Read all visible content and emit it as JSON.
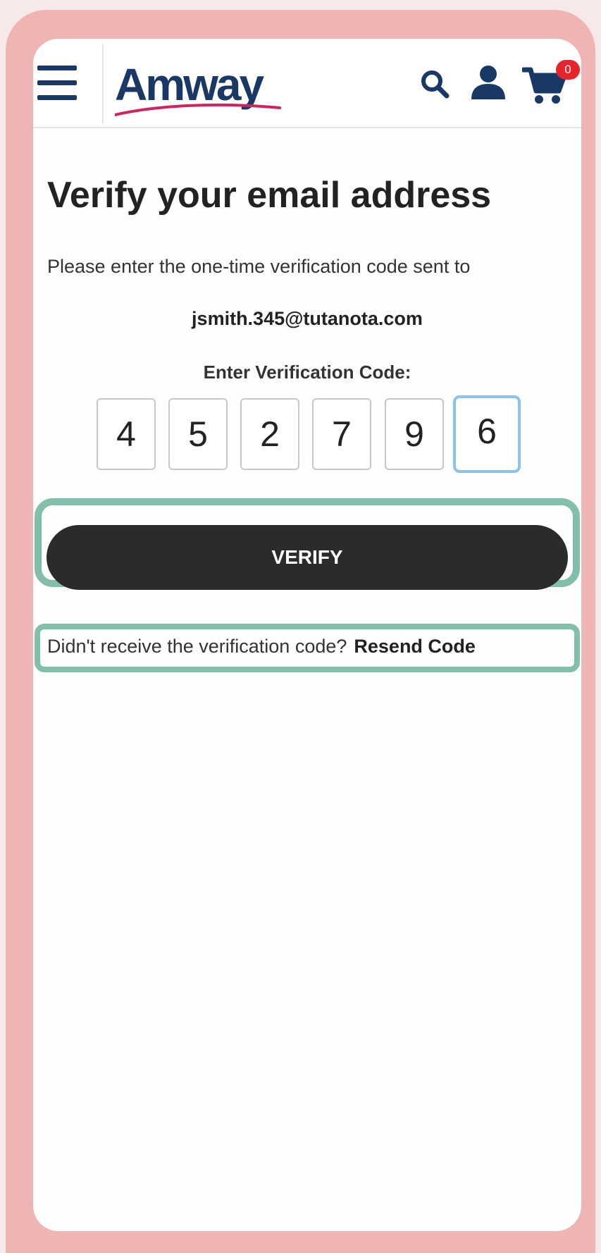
{
  "header": {
    "logo_text": "Amway",
    "cart_count": "0"
  },
  "main": {
    "title": "Verify your email address",
    "instruction": "Please enter the one-time verification code sent to",
    "email": "jsmith.345@tutanota.com",
    "code_label": "Enter Verification Code:",
    "code_digits": [
      "4",
      "5",
      "2",
      "7",
      "9",
      "6"
    ],
    "verify_label": "VERIFY",
    "resend_prompt": "Didn't receive the verification code?",
    "resend_link": "Resend Code"
  },
  "icons": {
    "menu": "menu-icon",
    "search": "search-icon",
    "account": "user-icon",
    "cart": "cart-icon"
  },
  "colors": {
    "brand_navy": "#1a3866",
    "brand_swoosh": "#d0245a",
    "badge_red": "#e5242b",
    "button_dark": "#2b2b2b",
    "active_input_border": "#8cc2f0",
    "highlight_green": "#82bfab",
    "frame_pink": "#efb4b4"
  }
}
